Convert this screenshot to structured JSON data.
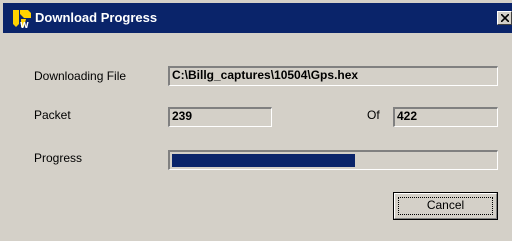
{
  "window": {
    "title": "Download Progress",
    "icon": "tw-app-icon",
    "close_icon": "close-icon"
  },
  "labels": {
    "downloading_file": "Downloading File",
    "packet": "Packet",
    "of": "Of",
    "progress": "Progress"
  },
  "fields": {
    "file_path": "C:\\Billg_captures\\10504\\Gps.hex",
    "packet_current": "239",
    "packet_total": "422"
  },
  "progress": {
    "fraction": 0.566
  },
  "buttons": {
    "cancel_label": "Cancel"
  },
  "colors": {
    "titlebar": "#0a246a",
    "progress_fill": "#0a246a",
    "dialog_face": "#d4d0c8"
  }
}
